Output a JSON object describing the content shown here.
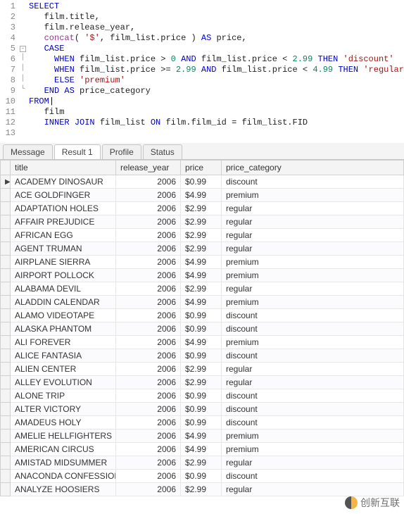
{
  "editor": {
    "lines": [
      {
        "n": 1,
        "fold": "",
        "tokens": [
          {
            "t": "kw",
            "v": "SELECT"
          }
        ]
      },
      {
        "n": 2,
        "fold": "",
        "tokens": [
          {
            "t": "plain",
            "v": "   film.title,"
          }
        ]
      },
      {
        "n": 3,
        "fold": "",
        "tokens": [
          {
            "t": "plain",
            "v": "   film.release_year,"
          }
        ]
      },
      {
        "n": 4,
        "fold": "",
        "tokens": [
          {
            "t": "plain",
            "v": "   "
          },
          {
            "t": "func",
            "v": "concat"
          },
          {
            "t": "plain",
            "v": "( "
          },
          {
            "t": "str",
            "v": "'$'"
          },
          {
            "t": "plain",
            "v": ", film_list.price ) "
          },
          {
            "t": "kw",
            "v": "AS"
          },
          {
            "t": "plain",
            "v": " price,"
          }
        ]
      },
      {
        "n": 5,
        "fold": "[-]",
        "tokens": [
          {
            "t": "plain",
            "v": "   "
          },
          {
            "t": "kw",
            "v": "CASE"
          }
        ]
      },
      {
        "n": 6,
        "fold": "|",
        "tokens": [
          {
            "t": "plain",
            "v": "     "
          },
          {
            "t": "kw",
            "v": "WHEN"
          },
          {
            "t": "plain",
            "v": " film_list.price > "
          },
          {
            "t": "num",
            "v": "0"
          },
          {
            "t": "plain",
            "v": " "
          },
          {
            "t": "kw",
            "v": "AND"
          },
          {
            "t": "plain",
            "v": " film_list.price < "
          },
          {
            "t": "num",
            "v": "2.99"
          },
          {
            "t": "plain",
            "v": " "
          },
          {
            "t": "kw",
            "v": "THEN"
          },
          {
            "t": "plain",
            "v": " "
          },
          {
            "t": "str",
            "v": "'discount'"
          }
        ]
      },
      {
        "n": 7,
        "fold": "|",
        "tokens": [
          {
            "t": "plain",
            "v": "     "
          },
          {
            "t": "kw",
            "v": "WHEN"
          },
          {
            "t": "plain",
            "v": " film_list.price >= "
          },
          {
            "t": "num",
            "v": "2.99"
          },
          {
            "t": "plain",
            "v": " "
          },
          {
            "t": "kw",
            "v": "AND"
          },
          {
            "t": "plain",
            "v": " film_list.price < "
          },
          {
            "t": "num",
            "v": "4.99"
          },
          {
            "t": "plain",
            "v": " "
          },
          {
            "t": "kw",
            "v": "THEN"
          },
          {
            "t": "plain",
            "v": " "
          },
          {
            "t": "str",
            "v": "'regular'"
          }
        ]
      },
      {
        "n": 8,
        "fold": "|",
        "tokens": [
          {
            "t": "plain",
            "v": "     "
          },
          {
            "t": "kw",
            "v": "ELSE"
          },
          {
            "t": "plain",
            "v": " "
          },
          {
            "t": "str",
            "v": "'premium'"
          }
        ]
      },
      {
        "n": 9,
        "fold": "L",
        "tokens": [
          {
            "t": "plain",
            "v": "   "
          },
          {
            "t": "kw",
            "v": "END"
          },
          {
            "t": "plain",
            "v": " "
          },
          {
            "t": "kw",
            "v": "AS"
          },
          {
            "t": "plain",
            "v": " price_category"
          }
        ]
      },
      {
        "n": 10,
        "fold": "",
        "tokens": [
          {
            "t": "kw",
            "v": "FROM"
          }
        ],
        "cursor": true
      },
      {
        "n": 11,
        "fold": "",
        "tokens": [
          {
            "t": "plain",
            "v": "   film"
          }
        ]
      },
      {
        "n": 12,
        "fold": "",
        "tokens": [
          {
            "t": "plain",
            "v": "   "
          },
          {
            "t": "kw",
            "v": "INNER"
          },
          {
            "t": "plain",
            "v": " "
          },
          {
            "t": "kw",
            "v": "JOIN"
          },
          {
            "t": "plain",
            "v": " film_list "
          },
          {
            "t": "kw",
            "v": "ON"
          },
          {
            "t": "plain",
            "v": " film.film_id = film_list.FID"
          }
        ]
      },
      {
        "n": 13,
        "fold": "",
        "tokens": []
      }
    ]
  },
  "tabs": {
    "message": "Message",
    "result": "Result 1",
    "profile": "Profile",
    "status": "Status"
  },
  "columns": {
    "title": "title",
    "release_year": "release_year",
    "price": "price",
    "price_category": "price_category"
  },
  "rows": [
    {
      "title": "ACADEMY DINOSAUR",
      "release_year": "2006",
      "price": "$0.99",
      "price_category": "discount",
      "current": true
    },
    {
      "title": "ACE GOLDFINGER",
      "release_year": "2006",
      "price": "$4.99",
      "price_category": "premium"
    },
    {
      "title": "ADAPTATION HOLES",
      "release_year": "2006",
      "price": "$2.99",
      "price_category": "regular"
    },
    {
      "title": "AFFAIR PREJUDICE",
      "release_year": "2006",
      "price": "$2.99",
      "price_category": "regular"
    },
    {
      "title": "AFRICAN EGG",
      "release_year": "2006",
      "price": "$2.99",
      "price_category": "regular"
    },
    {
      "title": "AGENT TRUMAN",
      "release_year": "2006",
      "price": "$2.99",
      "price_category": "regular"
    },
    {
      "title": "AIRPLANE SIERRA",
      "release_year": "2006",
      "price": "$4.99",
      "price_category": "premium"
    },
    {
      "title": "AIRPORT POLLOCK",
      "release_year": "2006",
      "price": "$4.99",
      "price_category": "premium"
    },
    {
      "title": "ALABAMA DEVIL",
      "release_year": "2006",
      "price": "$2.99",
      "price_category": "regular"
    },
    {
      "title": "ALADDIN CALENDAR",
      "release_year": "2006",
      "price": "$4.99",
      "price_category": "premium"
    },
    {
      "title": "ALAMO VIDEOTAPE",
      "release_year": "2006",
      "price": "$0.99",
      "price_category": "discount"
    },
    {
      "title": "ALASKA PHANTOM",
      "release_year": "2006",
      "price": "$0.99",
      "price_category": "discount"
    },
    {
      "title": "ALI FOREVER",
      "release_year": "2006",
      "price": "$4.99",
      "price_category": "premium"
    },
    {
      "title": "ALICE FANTASIA",
      "release_year": "2006",
      "price": "$0.99",
      "price_category": "discount"
    },
    {
      "title": "ALIEN CENTER",
      "release_year": "2006",
      "price": "$2.99",
      "price_category": "regular"
    },
    {
      "title": "ALLEY EVOLUTION",
      "release_year": "2006",
      "price": "$2.99",
      "price_category": "regular"
    },
    {
      "title": "ALONE TRIP",
      "release_year": "2006",
      "price": "$0.99",
      "price_category": "discount"
    },
    {
      "title": "ALTER VICTORY",
      "release_year": "2006",
      "price": "$0.99",
      "price_category": "discount"
    },
    {
      "title": "AMADEUS HOLY",
      "release_year": "2006",
      "price": "$0.99",
      "price_category": "discount"
    },
    {
      "title": "AMELIE HELLFIGHTERS",
      "release_year": "2006",
      "price": "$4.99",
      "price_category": "premium"
    },
    {
      "title": "AMERICAN CIRCUS",
      "release_year": "2006",
      "price": "$4.99",
      "price_category": "premium"
    },
    {
      "title": "AMISTAD MIDSUMMER",
      "release_year": "2006",
      "price": "$2.99",
      "price_category": "regular"
    },
    {
      "title": "ANACONDA CONFESSIONS",
      "release_year": "2006",
      "price": "$0.99",
      "price_category": "discount"
    },
    {
      "title": "ANALYZE HOOSIERS",
      "release_year": "2006",
      "price": "$2.99",
      "price_category": "regular"
    }
  ],
  "watermark": {
    "text": "创新互联"
  }
}
